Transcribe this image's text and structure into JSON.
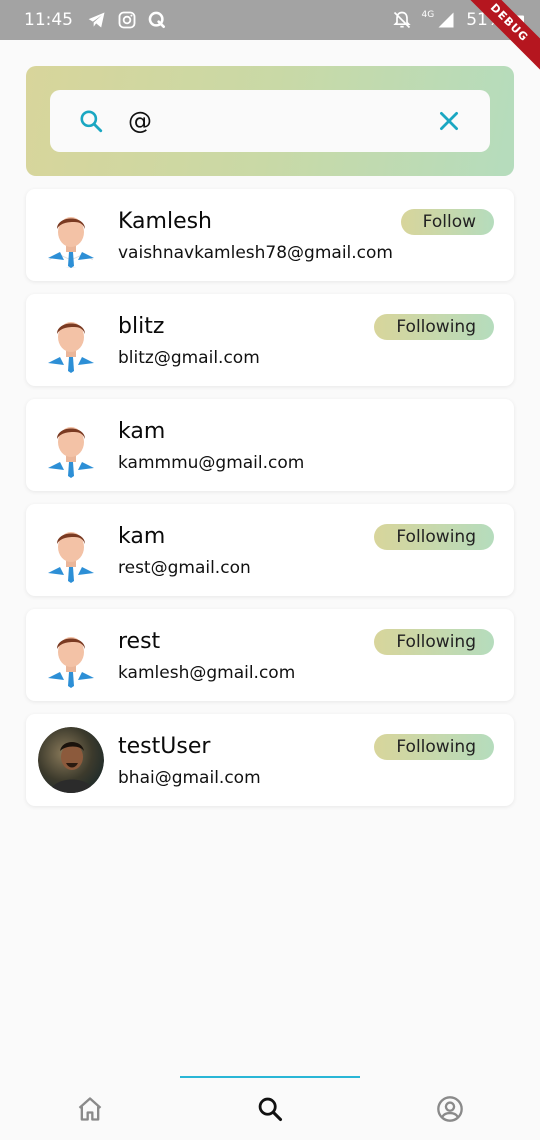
{
  "status_bar": {
    "time": "11:45",
    "battery": "51%",
    "network": "4G",
    "left_icons": [
      "telegram-icon",
      "instagram-icon",
      "q-app-icon"
    ],
    "right_icons": [
      "notifications-off-icon",
      "signal-icon",
      "battery-icon"
    ]
  },
  "debug_banner": "DEBUG",
  "search": {
    "value": "@",
    "icon": "search-icon",
    "clear_icon": "close-icon",
    "accent": "#1aa7c2"
  },
  "users": [
    {
      "name": "Kamlesh",
      "email": "vaishnavkamlesh78@gmail.com",
      "action": "Follow",
      "avatar": "default"
    },
    {
      "name": "blitz",
      "email": "blitz@gmail.com",
      "action": "Following",
      "avatar": "default"
    },
    {
      "name": "kam",
      "email": "kammmu@gmail.com",
      "action": "",
      "avatar": "default"
    },
    {
      "name": "kam",
      "email": "rest@gmail.con",
      "action": "Following",
      "avatar": "default"
    },
    {
      "name": "rest",
      "email": "kamlesh@gmail.com",
      "action": "Following",
      "avatar": "default"
    },
    {
      "name": "testUser",
      "email": "bhai@gmail.com",
      "action": "Following",
      "avatar": "photo"
    }
  ],
  "bottom_nav": {
    "items": [
      "home-icon",
      "search-icon",
      "account-icon"
    ],
    "active_index": 1,
    "indicator_color": "#29b6d6"
  },
  "colors": {
    "gradient_start": "#d8d59b",
    "gradient_end": "#b5dcbd",
    "status_bar": "#a3a3a3",
    "debug": "#b5161f"
  }
}
